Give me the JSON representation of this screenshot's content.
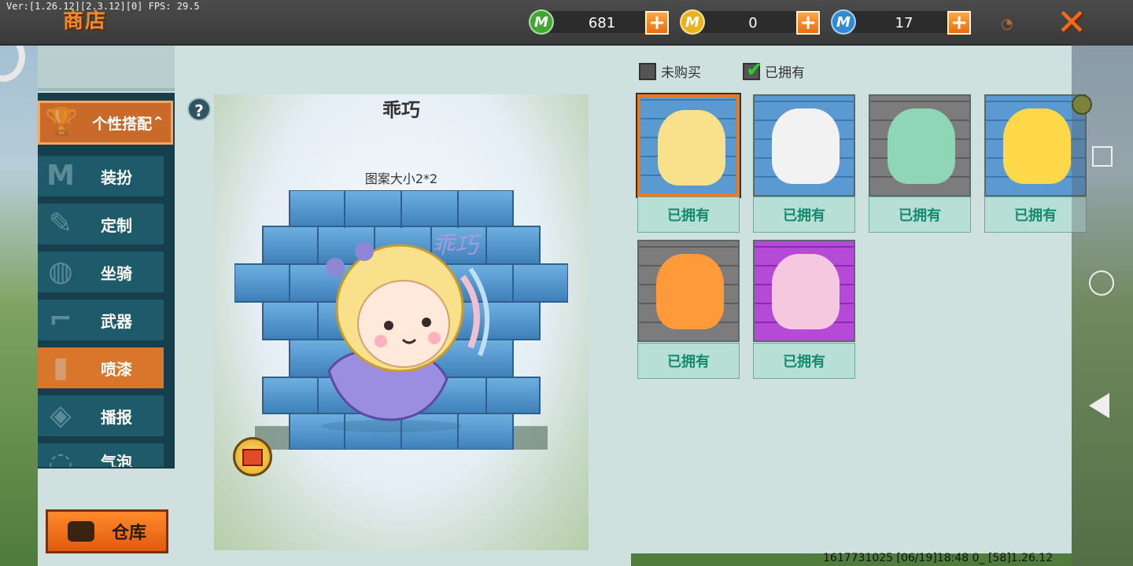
{
  "debug": {
    "text": "Ver:[1.26.12][2.3.12][0] FPS: 29.5"
  },
  "header": {
    "title": "商店",
    "currencies": [
      {
        "icon": "green-m-coin-icon",
        "value": "681",
        "color": "#3fa832"
      },
      {
        "icon": "gold-m-coin-icon",
        "value": "0",
        "color": "#e8b418"
      },
      {
        "icon": "blue-m-coin-icon",
        "value": "17",
        "color": "#2f8ad6"
      }
    ],
    "plus_label": "+",
    "close_label": "✕"
  },
  "sidebar": {
    "main_category": "个性搭配",
    "items": [
      {
        "label": "装扮",
        "icon": "shirt-icon"
      },
      {
        "label": "定制",
        "icon": "brush-icon"
      },
      {
        "label": "坐骑",
        "icon": "mount-icon"
      },
      {
        "label": "武器",
        "icon": "gun-icon"
      },
      {
        "label": "喷漆",
        "icon": "spray-can-icon",
        "active": true
      },
      {
        "label": "播报",
        "icon": "broadcast-icon"
      },
      {
        "label": "气泡",
        "icon": "bubble-icon"
      }
    ],
    "warehouse_label": "仓库"
  },
  "preview": {
    "help_label": "?",
    "title": "乖巧",
    "pattern_size": "图案大小2*2"
  },
  "filters": {
    "not_bought": "未购买",
    "owned": "已拥有",
    "owned_checked": true
  },
  "items": [
    {
      "status": "已拥有",
      "bg": "blue",
      "selected": true,
      "art": "blonde-fairy-girl"
    },
    {
      "status": "已拥有",
      "bg": "blue",
      "selected": false,
      "art": "panda-magnifier"
    },
    {
      "status": "已拥有",
      "bg": "gray",
      "selected": false,
      "art": "green-hood-kid"
    },
    {
      "status": "已拥有",
      "bg": "blue",
      "selected": false,
      "art": "yellow-hair-girl",
      "timed": true
    },
    {
      "status": "已拥有",
      "bg": "gray",
      "selected": false,
      "art": "flame-hair-boy"
    },
    {
      "status": "已拥有",
      "bg": "purple",
      "selected": false,
      "art": "two-girls-hug"
    }
  ],
  "footer": {
    "text": "1617731025    [06/19]18:48 0_ [58]1.26.12"
  }
}
